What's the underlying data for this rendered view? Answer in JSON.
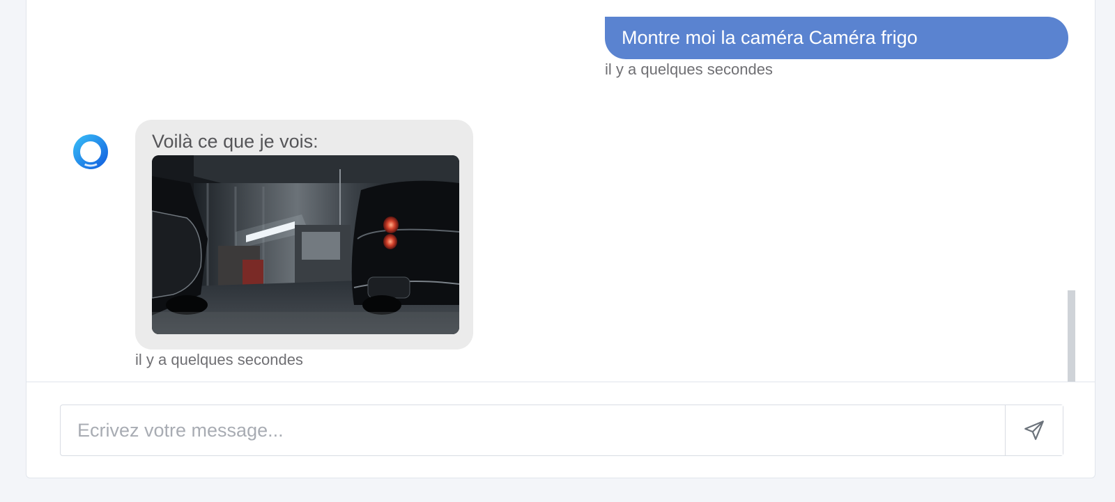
{
  "conversation": {
    "user_message": {
      "text": "Montre moi la caméra Caméra frigo",
      "time": "il y a quelques secondes"
    },
    "bot_message": {
      "text": "Voilà ce que je vois:",
      "image_alt": "Caméra frigo",
      "time": "il y a quelques secondes"
    }
  },
  "composer": {
    "placeholder": "Ecrivez votre message..."
  },
  "icons": {
    "avatar": "assistant-ring-logo",
    "send": "paper-plane-icon"
  },
  "colors": {
    "user_bubble": "#5a83d0",
    "bot_bubble": "#ebebeb",
    "background": "#f3f5f9",
    "avatar_ring": "#1a8bf2"
  }
}
